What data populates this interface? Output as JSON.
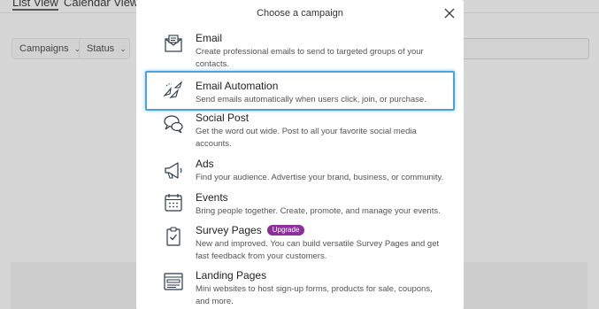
{
  "background": {
    "tabs": [
      {
        "label": "List View"
      },
      {
        "label": "Calendar View"
      }
    ],
    "filters": [
      {
        "label": "Campaigns"
      },
      {
        "label": "Status"
      }
    ]
  },
  "modal": {
    "title": "Choose a campaign",
    "items": [
      {
        "name": "Email",
        "description": "Create professional emails to send to targeted groups of your contacts.",
        "icon": "email-icon"
      },
      {
        "name": "Email Automation",
        "description": "Send emails automatically when users click, join, or purchase.",
        "icon": "automation-icon",
        "selected": true
      },
      {
        "name": "Social Post",
        "description": "Get the word out wide. Post to all your favorite social media accounts.",
        "icon": "speech-bubbles-icon"
      },
      {
        "name": "Ads",
        "description": "Find your audience. Advertise your brand, business, or community.",
        "icon": "megaphone-icon"
      },
      {
        "name": "Events",
        "description": "Bring people together. Create, promote, and manage your events.",
        "icon": "calendar-icon"
      },
      {
        "name": "Survey Pages",
        "badge": "Upgrade",
        "description": "New and improved. You can build versatile Survey Pages and get fast feedback from your customers.",
        "icon": "clipboard-checklist-icon"
      },
      {
        "name": "Landing Pages",
        "description": "Mini websites to host sign-up forms, products for sale, coupons, and more.",
        "icon": "landing-page-icon"
      }
    ]
  },
  "colors": {
    "selection_border": "#4aa3df",
    "badge_bg": "#8a2f9c",
    "overlay": "#d6d6d6"
  }
}
